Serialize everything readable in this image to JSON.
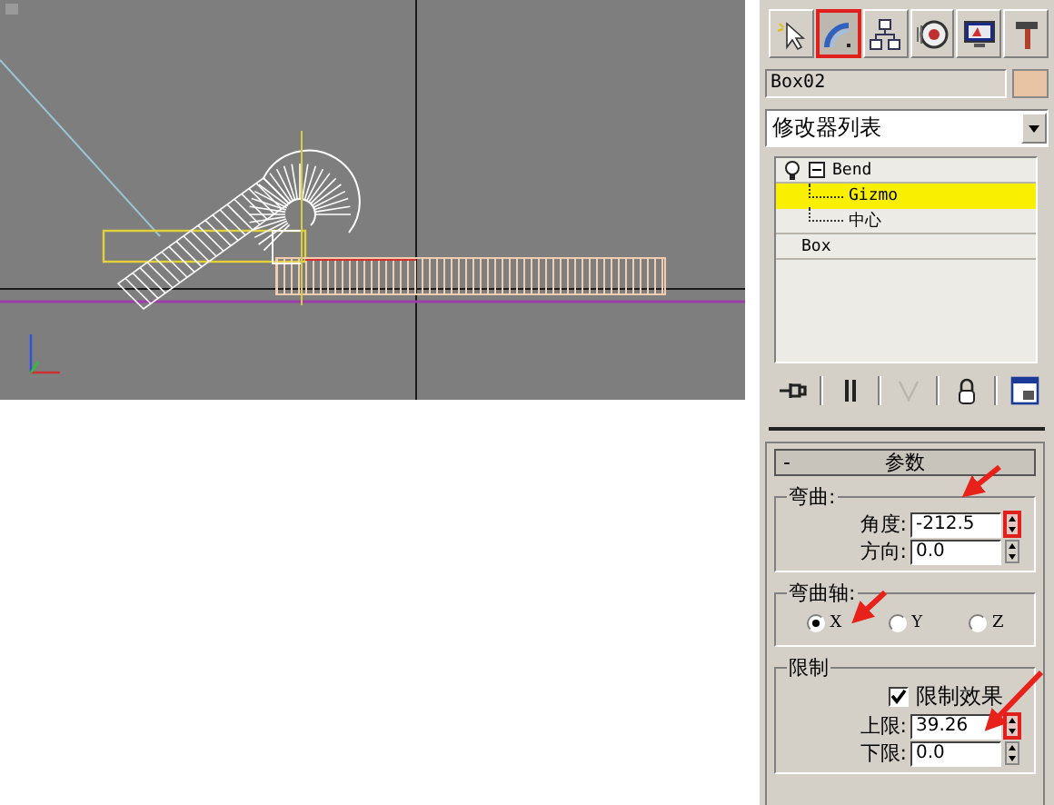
{
  "command_tabs": [
    {
      "kind": "create",
      "selected": false
    },
    {
      "kind": "modify",
      "selected": true
    },
    {
      "kind": "hierarchy",
      "selected": false
    },
    {
      "kind": "motion",
      "selected": false
    },
    {
      "kind": "display",
      "selected": false
    },
    {
      "kind": "utilities",
      "selected": false
    }
  ],
  "object": {
    "name": "Box02",
    "color": "#e8c4a4"
  },
  "modifier_list": {
    "value": "修改器列表"
  },
  "stack": [
    {
      "label": "Bend",
      "expanded": true,
      "selected": false,
      "children": [
        {
          "label": "Gizmo",
          "selected": true
        },
        {
          "label": "中心",
          "selected": false
        }
      ]
    },
    {
      "label": "Box",
      "selected": false
    }
  ],
  "stack_tools": [
    {
      "kind": "pin",
      "disabled": false
    },
    {
      "kind": "show-end",
      "disabled": false
    },
    {
      "kind": "unique",
      "disabled": true
    },
    {
      "kind": "remove",
      "disabled": false
    },
    {
      "kind": "configure",
      "disabled": false
    }
  ],
  "rollout": {
    "toggle": "-",
    "title": "参数"
  },
  "bend": {
    "title": "弯曲:",
    "fields": [
      {
        "label": "角度:",
        "value": "-212.5",
        "highlighted": true
      },
      {
        "label": "方向:",
        "value": "0.0",
        "highlighted": false
      }
    ]
  },
  "bend_axis": {
    "title": "弯曲轴:",
    "options": [
      {
        "label": "X",
        "selected": true
      },
      {
        "label": "Y",
        "selected": false
      },
      {
        "label": "Z",
        "selected": false
      }
    ]
  },
  "limits": {
    "title": "限制",
    "checkbox": {
      "label": "限制效果",
      "checked": true
    },
    "fields": [
      {
        "label": "上限:",
        "value": "39.26",
        "highlighted": true
      },
      {
        "label": "下限:",
        "value": "0.0",
        "highlighted": false
      }
    ]
  }
}
